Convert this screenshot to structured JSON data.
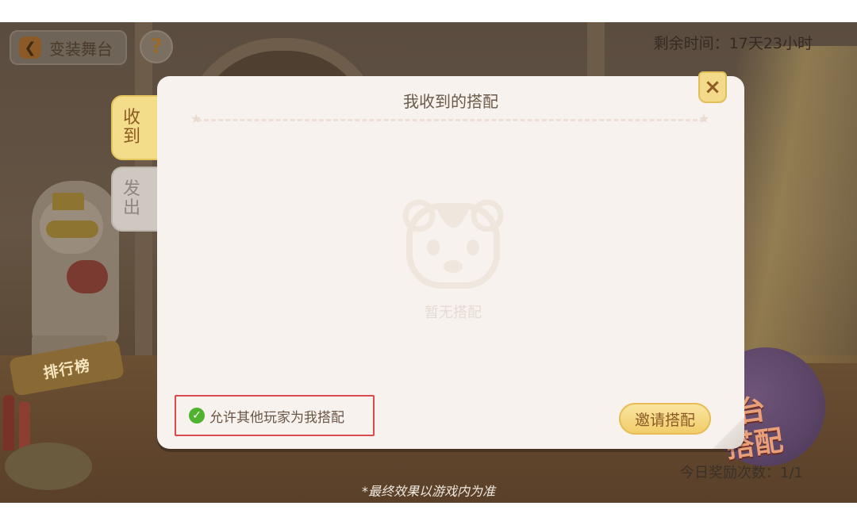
{
  "top_bar": {
    "back_label": "变装舞台",
    "help_label": "?",
    "remaining_time": "剩余时间：17天23小时"
  },
  "background": {
    "rank_banner": "排行榜",
    "promo_text_line1": "台",
    "promo_text_line2": "搭配"
  },
  "tabs": [
    {
      "label": "收到",
      "active": true
    },
    {
      "label": "发出",
      "active": false
    }
  ],
  "dialog": {
    "title": "我收到的搭配",
    "close_label": "×",
    "empty_text": "暂无搭配",
    "allow_label": "允许其他玩家为我搭配",
    "allow_checked": true,
    "invite_label": "邀请搭配"
  },
  "footer": {
    "reward_count": "今日奖励次数：1/1",
    "disclaimer": "*最终效果以游戏内为准"
  },
  "colors": {
    "dialog_bg": "#f7f2ee",
    "accent_yellow": "#f3d98a",
    "highlight_red": "#d94b4b",
    "check_green": "#4fb32f"
  }
}
